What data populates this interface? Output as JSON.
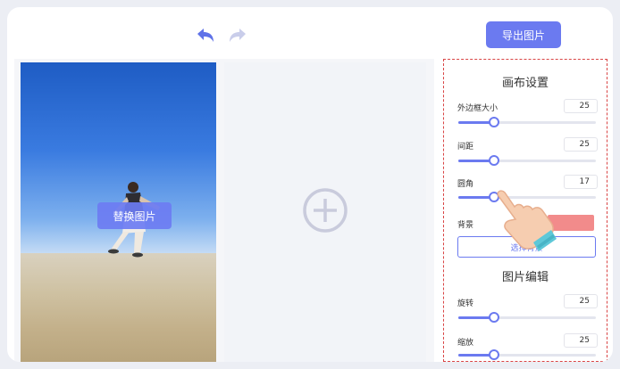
{
  "toolbar": {
    "undo_icon": "undo-icon",
    "redo_icon": "redo-icon",
    "export_label": "导出图片"
  },
  "canvas": {
    "replace_label": "替换图片",
    "add_icon": "plus-circle-icon"
  },
  "panel": {
    "canvas_settings_title": "画布设置",
    "border_label": "外边框大小",
    "border_value": "25",
    "border_fraction": 0.26,
    "gap_label": "间距",
    "gap_value": "25",
    "gap_fraction": 0.26,
    "radius_label": "圆角",
    "radius_value": "17",
    "radius_fraction": 0.26,
    "background_label": "背景",
    "background_color": "#f28b8b",
    "choose_bg_label": "选择背景",
    "image_edit_title": "图片编辑",
    "rotate_label": "旋转",
    "rotate_value": "25",
    "rotate_fraction": 0.26,
    "scale_label": "缩放",
    "scale_value": "25",
    "scale_fraction": 0.26
  },
  "colors": {
    "accent": "#6b7af0",
    "highlight_border": "#d94545"
  }
}
